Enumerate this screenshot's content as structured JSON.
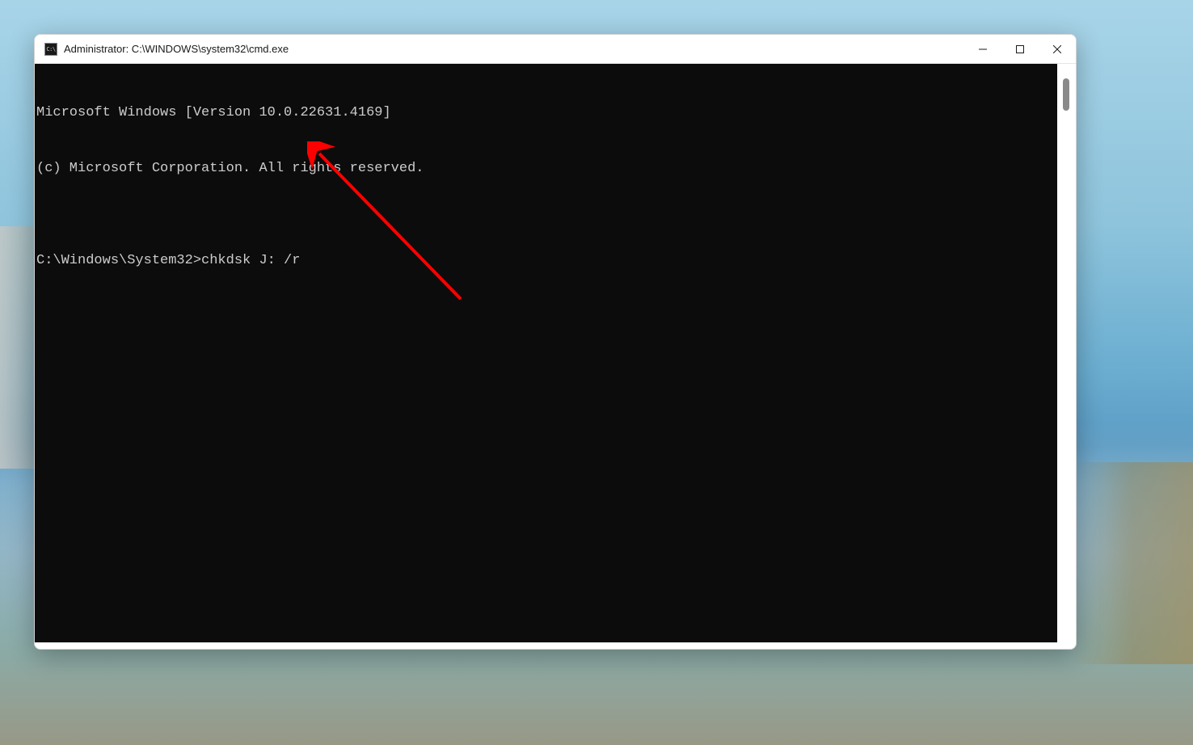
{
  "window": {
    "title": "Administrator: C:\\WINDOWS\\system32\\cmd.exe",
    "icon_label": "C:\\"
  },
  "terminal": {
    "lines": [
      "Microsoft Windows [Version 10.0.22631.4169]",
      "(c) Microsoft Corporation. All rights reserved.",
      "",
      "C:\\Windows\\System32>chkdsk J: /r"
    ]
  },
  "annotation": {
    "type": "arrow",
    "color": "#ff0000"
  }
}
